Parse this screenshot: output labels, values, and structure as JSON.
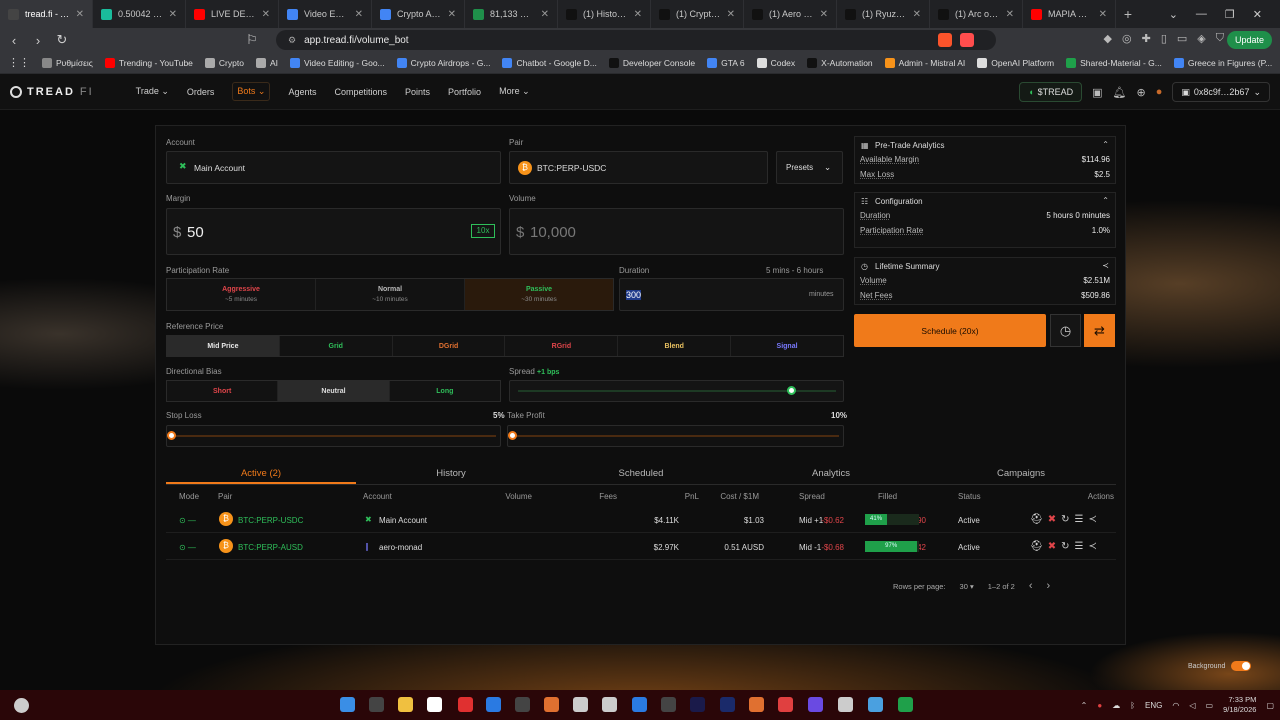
{
  "browser": {
    "tabs": [
      {
        "label": "tread.fi - Alg",
        "color": "#444",
        "active": true
      },
      {
        "label": "0.50042 | TREAD",
        "color": "#1abc9c"
      },
      {
        "label": "LIVE DEBATE - K",
        "color": "#ff0000"
      },
      {
        "label": "Video Editing - G",
        "color": "#4285f4"
      },
      {
        "label": "Crypto Airdrops",
        "color": "#4285f4"
      },
      {
        "label": "81,133 USD | BTC",
        "color": "#1f8f4a"
      },
      {
        "label": "(1) History / X",
        "color": "#111"
      },
      {
        "label": "(1) CryptoTelugu",
        "color": "#111"
      },
      {
        "label": "(1) Aero - AI & C",
        "color": "#111"
      },
      {
        "label": "(1) Ryuzaki SEI o",
        "color": "#111"
      },
      {
        "label": "(1) Arc on X: \"Wh",
        "color": "#111"
      },
      {
        "label": "ΜΑΡΙΑ ΚΑΡΥΣΤΙΑ",
        "color": "#ff0000"
      }
    ],
    "new_tab": "+",
    "url": "app.tread.fi/volume_bot",
    "update_label": "Update",
    "bookmarks": [
      {
        "label": "Ρυθμίσεις",
        "color": "#888"
      },
      {
        "label": "Trending - YouTube",
        "color": "#ff0000"
      },
      {
        "label": "Crypto",
        "color": "#aaa"
      },
      {
        "label": "AI",
        "color": "#aaa"
      },
      {
        "label": "Video Editing - Goo...",
        "color": "#4285f4"
      },
      {
        "label": "Crypto Airdrops - G...",
        "color": "#4285f4"
      },
      {
        "label": "Chatbot - Google D...",
        "color": "#4285f4"
      },
      {
        "label": "Developer Console",
        "color": "#111"
      },
      {
        "label": "GTA 6",
        "color": "#4285f4"
      },
      {
        "label": "Codex",
        "color": "#ddd"
      },
      {
        "label": "X-Automation",
        "color": "#111"
      },
      {
        "label": "Admin - Mistral AI",
        "color": "#f7931a"
      },
      {
        "label": "OpenAI Platform",
        "color": "#ddd"
      },
      {
        "label": "Shared-Material - G...",
        "color": "#1fa04a"
      },
      {
        "label": "Greece in Figures (P...",
        "color": "#4285f4"
      }
    ]
  },
  "nav": {
    "logo_main": "TREAD",
    "logo_sub": "FI",
    "items": [
      {
        "label": "Trade ⌄",
        "active": false
      },
      {
        "label": "Orders",
        "active": false
      },
      {
        "label": "Bots ⌄",
        "active": true
      },
      {
        "label": "Agents",
        "active": false
      },
      {
        "label": "Competitions",
        "active": false
      },
      {
        "label": "Points",
        "active": false
      },
      {
        "label": "Portfolio",
        "active": false
      },
      {
        "label": "More ⌄",
        "active": false
      }
    ],
    "token_label": "$TREAD",
    "wallet_label": "0x8c9f…2b67"
  },
  "form": {
    "account_label": "Account",
    "account_value": "Main Account",
    "pair_label": "Pair",
    "pair_value": "BTC:PERP-USDC",
    "presets_label": "Presets",
    "margin_label": "Margin",
    "margin_currency": "$",
    "margin_value": "50",
    "leverage": "10x",
    "volume_label": "Volume",
    "volume_currency": "$",
    "volume_placeholder": "10,000",
    "participation_label": "Participation Rate",
    "participation_options": [
      {
        "label": "Aggressive",
        "sub": "~5 minutes",
        "color": "#e0454a",
        "selected": false
      },
      {
        "label": "Normal",
        "sub": "~10 minutes",
        "color": "#bbbbbb",
        "selected": false
      },
      {
        "label": "Passive",
        "sub": "~30 minutes",
        "color": "#2fbf5a",
        "selected": true
      }
    ],
    "duration_label": "Duration",
    "duration_range": "5 mins - 6 hours",
    "duration_value": "300",
    "duration_unit": "minutes",
    "reference_label": "Reference Price",
    "reference_options": [
      {
        "label": "Mid Price",
        "color": "#e8e8e8",
        "selected": true
      },
      {
        "label": "Grid",
        "color": "#2fbf5a",
        "selected": false
      },
      {
        "label": "DGrid",
        "color": "#e07030",
        "selected": false
      },
      {
        "label": "RGrid",
        "color": "#e0454a",
        "selected": false
      },
      {
        "label": "Blend",
        "color": "#e8c060",
        "selected": false
      },
      {
        "label": "Signal",
        "color": "#7a7aff",
        "selected": false
      }
    ],
    "bias_label": "Directional Bias",
    "bias_options": [
      {
        "label": "Short",
        "color": "#e0454a",
        "selected": false
      },
      {
        "label": "Neutral",
        "color": "#dddddd",
        "selected": true
      },
      {
        "label": "Long",
        "color": "#2fbf5a",
        "selected": false
      }
    ],
    "spread_label": "Spread",
    "spread_value": "+1 bps",
    "spread_level": 0.43,
    "stop_loss_label": "Stop Loss",
    "stop_loss_value": "5%",
    "take_profit_label": "Take Profit",
    "take_profit_value": "10%"
  },
  "analytics": {
    "title": "Pre-Trade Analytics",
    "rows": [
      {
        "k": "Available Margin",
        "v": "$114.96"
      },
      {
        "k": "Max Loss",
        "v": "$2.5"
      }
    ]
  },
  "config": {
    "title": "Configuration",
    "rows": [
      {
        "k": "Duration",
        "v": "5 hours 0 minutes"
      },
      {
        "k": "Participation Rate",
        "v": "1.0%"
      }
    ]
  },
  "lifetime": {
    "title": "Lifetime Summary",
    "rows": [
      {
        "k": "Volume",
        "v": "$2.51M"
      },
      {
        "k": "Net Fees",
        "v": "$509.86"
      }
    ]
  },
  "schedule_label": "Schedule (20x)",
  "orders": {
    "tabs": [
      {
        "label": "Active (2)",
        "active": true
      },
      {
        "label": "History",
        "active": false
      },
      {
        "label": "Scheduled",
        "active": false
      },
      {
        "label": "Analytics",
        "active": false
      },
      {
        "label": "Campaigns",
        "active": false
      }
    ],
    "headers": [
      "Mode",
      "Pair",
      "Account",
      "Volume",
      "Fees",
      "PnL",
      "Cost / $1M",
      "Spread",
      "Filled",
      "Status",
      "Actions"
    ],
    "rows": [
      {
        "mode": "⊙ —",
        "pair": "BTC:PERP-USDC",
        "account": "Main Account",
        "volume": "$4.11K",
        "fees": "$1.03",
        "pnl": "-$0.62",
        "cost": "$401.90",
        "spread": "Mid +1",
        "filled": "41%",
        "filled_frac": 0.41,
        "status": "Active"
      },
      {
        "mode": "⊙ —",
        "pair": "BTC:PERP-AUSD",
        "account": "aero-monad",
        "volume": "$2.97K",
        "fees": "0.51 AUSD",
        "pnl": "-$0.68",
        "cost": "$398.42",
        "spread": "Mid -1",
        "filled": "97%",
        "filled_frac": 0.97,
        "status": "Active"
      }
    ],
    "rows_per_page_label": "Rows per page:",
    "rows_per_page": "30",
    "range": "1–2 of 2"
  },
  "background_label": "Background",
  "taskbar": {
    "lang": "ENG",
    "time": "7:33 PM",
    "date": "9/18/2026"
  },
  "colors": {
    "accent": "#f07a1a",
    "positive": "#2fbf5a",
    "negative": "#e0454a"
  }
}
